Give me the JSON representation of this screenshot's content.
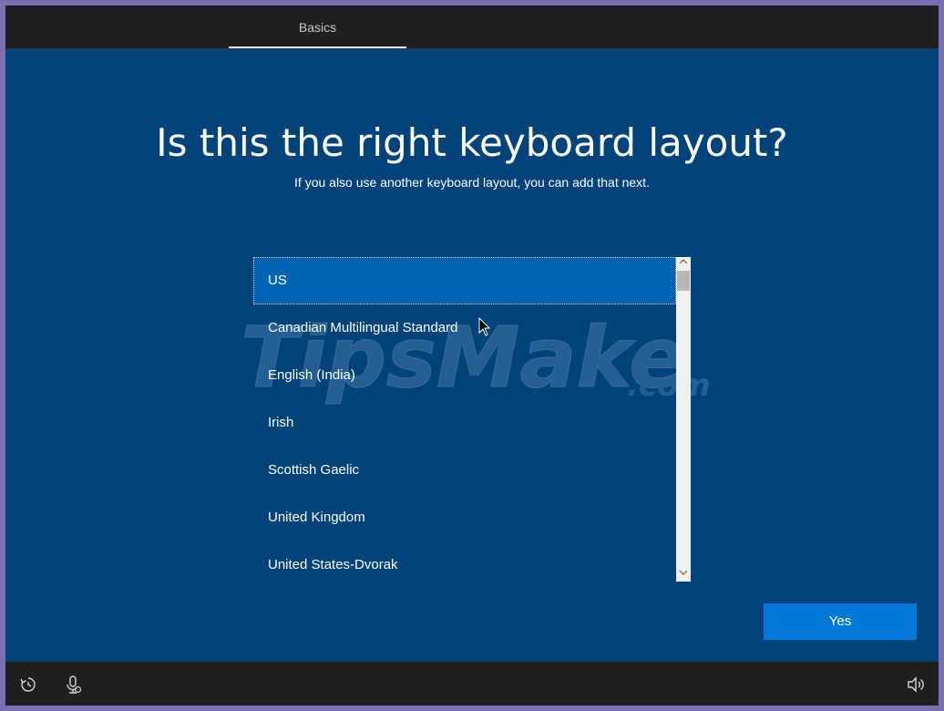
{
  "header": {
    "tab_label": "Basics"
  },
  "main": {
    "title": "Is this the right keyboard layout?",
    "subtitle": "If you also use another keyboard layout, you can add that next.",
    "watermark": "TipsMake.com"
  },
  "layouts": {
    "items": [
      {
        "label": "US",
        "selected": true
      },
      {
        "label": "Canadian Multilingual Standard"
      },
      {
        "label": "English (India)"
      },
      {
        "label": "Irish"
      },
      {
        "label": "Scottish Gaelic"
      },
      {
        "label": "United Kingdom"
      },
      {
        "label": "United States-Dvorak"
      }
    ]
  },
  "actions": {
    "yes_label": "Yes"
  },
  "footer": {
    "icons": [
      "ease-of-access-icon",
      "microphone-icon",
      "volume-icon"
    ]
  },
  "colors": {
    "background": "#00427a",
    "selected": "#0063b1",
    "button": "#0078d7",
    "bar": "#1f1f1f"
  }
}
